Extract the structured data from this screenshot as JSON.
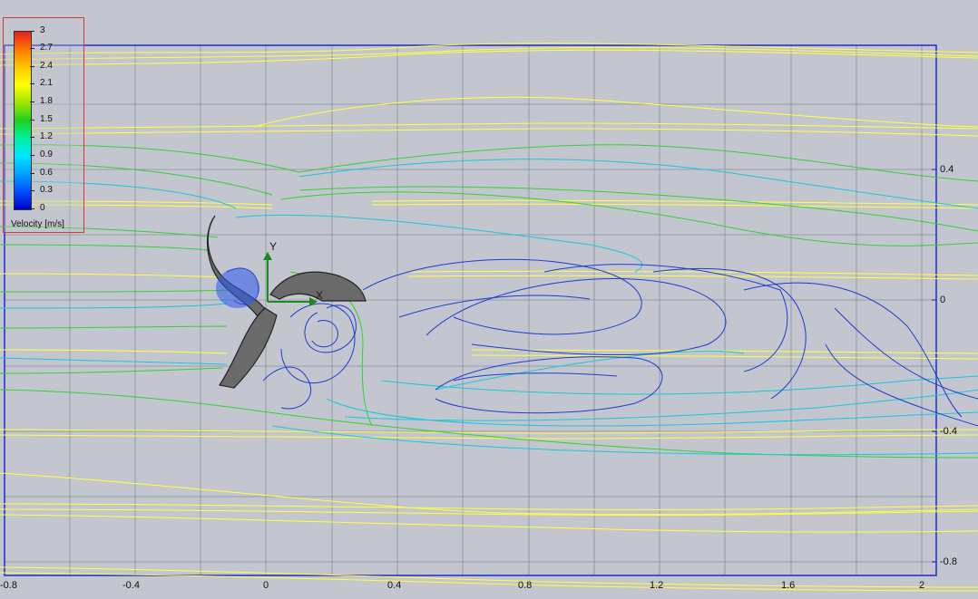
{
  "legend": {
    "title": "Velocity [m/s]",
    "ticks": [
      "3",
      "2.7",
      "2.4",
      "2.1",
      "1.8",
      "1.5",
      "1.2",
      "0.9",
      "0.6",
      "0.3",
      "0"
    ],
    "colors": [
      "#e61e1e",
      "#ff7800",
      "#ffc800",
      "#ffff00",
      "#a0e600",
      "#1ed21e",
      "#00f0a0",
      "#00e5ff",
      "#00a0ff",
      "#0050ff",
      "#0000c8"
    ]
  },
  "x_axis": {
    "labels": [
      "-0.8",
      "-0.4",
      "0",
      "0.4",
      "0.8",
      "1.2",
      "1.6",
      "2"
    ]
  },
  "y_axis": {
    "labels": [
      "0.4",
      "0",
      "-0.4",
      "-0.8"
    ]
  },
  "triad": {
    "y_label": "Y",
    "x_label": "X"
  },
  "colors": {
    "background": "#c3c6ce",
    "frame": "#1e28d2",
    "grid": "#8a8f9c",
    "blade": "#6a6a6a",
    "streamline_fast": "#ffff3c",
    "streamline_mid": "#32d232",
    "streamline_slow": "#1e3cd2"
  }
}
